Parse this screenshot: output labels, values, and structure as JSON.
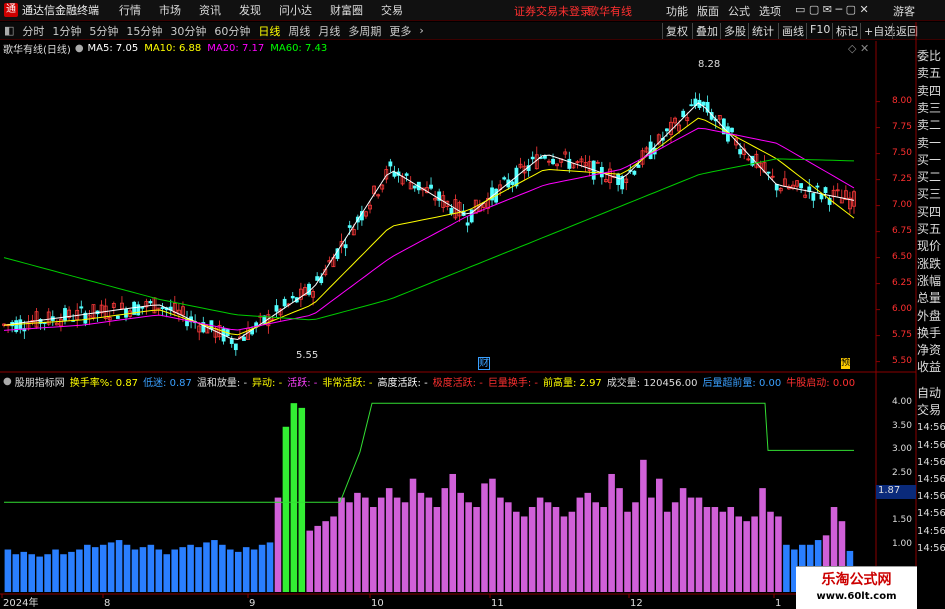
{
  "menubar": {
    "app_title": "通达信金融终端",
    "items": [
      "行情",
      "市场",
      "资讯",
      "发现",
      "问小达",
      "财富圈",
      "交易"
    ],
    "warning": "证券交易未登录",
    "stock_name": "歌华有线",
    "right_items": [
      "功能",
      "版面",
      "公式",
      "选项"
    ],
    "user": "游客"
  },
  "periodbar": {
    "periods": [
      "分时",
      "1分钟",
      "5分钟",
      "15分钟",
      "30分钟",
      "60分钟",
      "日线",
      "周线",
      "月线",
      "多周期",
      "更多"
    ],
    "active": "日线",
    "tools": [
      "复权",
      "叠加",
      "多股",
      "统计",
      "画线",
      "F10",
      "标记",
      "+自选",
      "返回"
    ]
  },
  "price_panel": {
    "title": "歌华有线(日线)",
    "ma_labels": [
      {
        "text": "MA5: 7.05",
        "color": "#ffffff"
      },
      {
        "text": "MA10: 6.88",
        "color": "#ffff00"
      },
      {
        "text": "MA20: 7.17",
        "color": "#ff00ff"
      },
      {
        "text": "MA60: 7.43",
        "color": "#00ff00"
      }
    ],
    "y_ticks": [
      "8.00",
      "7.75",
      "7.50",
      "7.25",
      "7.00",
      "6.75",
      "6.50",
      "6.25",
      "6.00",
      "5.75",
      "5.50"
    ],
    "high_label": "8.28",
    "low_label": "5.55",
    "marker_cai": "财",
    "marker_yu": "预"
  },
  "indicator_panel": {
    "title": "股朋指标网",
    "segments": [
      {
        "text": "换手率%: 0.87",
        "color": "#ffff00"
      },
      {
        "text": "低迷: 0.87",
        "color": "#3aa0ff"
      },
      {
        "text": "温和放量: -",
        "color": "#dddddd"
      },
      {
        "text": "异动: -",
        "color": "#ffff00"
      },
      {
        "text": "活跃: -",
        "color": "#ff40ff"
      },
      {
        "text": "非常活跃: -",
        "color": "#ffff00"
      },
      {
        "text": "高度活跃: -",
        "color": "#ffffff"
      },
      {
        "text": "极度活跃: -",
        "color": "#ff3030"
      },
      {
        "text": "巨量换手: -",
        "color": "#ff3030"
      },
      {
        "text": "前高量: 2.97",
        "color": "#ffff00"
      },
      {
        "text": "成交量: 120456.00",
        "color": "#dddddd"
      },
      {
        "text": "后量超前量: 0.00",
        "color": "#3aa0ff"
      },
      {
        "text": "牛股启动: 0.00",
        "color": "#ff3030"
      }
    ],
    "y_ticks": [
      "4.00",
      "3.50",
      "3.00",
      "2.50",
      "2.00",
      "1.50",
      "1.00"
    ],
    "current_value": "1.87"
  },
  "right_sidebar": {
    "upper": [
      "委比",
      "卖五",
      "卖四",
      "卖三",
      "卖二",
      "卖一",
      "买一",
      "买二",
      "买三",
      "买四",
      "买五",
      "现价",
      "涨跌",
      "涨幅",
      "总量",
      "外盘",
      "换手",
      "净资",
      "收益"
    ],
    "lower": [
      "自动",
      "交易",
      "14:56",
      "14:56",
      "14:56",
      "14:56",
      "14:56",
      "14:56",
      "14:56",
      "14:56"
    ]
  },
  "x_axis": [
    "2024年",
    "8",
    "9",
    "10",
    "11",
    "12",
    "1"
  ],
  "watermark": {
    "title": "乐淘公式网",
    "url": "www.60lt.com"
  },
  "chart_data": [
    {
      "type": "candlestick",
      "title": "歌华有线(日线)",
      "ylim": [
        5.4,
        8.4
      ],
      "x": [
        "2024-07",
        "2024-08",
        "2024-09",
        "2024-10",
        "2024-11",
        "2024-12",
        "2025-01"
      ],
      "series": [
        {
          "name": "MA5",
          "values": [
            5.85,
            5.95,
            6.05,
            5.7,
            6.2,
            7.35,
            6.9,
            7.5,
            7.25,
            8.0,
            7.2,
            7.05
          ]
        },
        {
          "name": "MA10",
          "values": [
            5.85,
            5.9,
            6.0,
            5.75,
            6.05,
            6.8,
            6.95,
            7.35,
            7.3,
            7.85,
            7.45,
            6.88
          ]
        },
        {
          "name": "MA20",
          "values": [
            5.8,
            5.85,
            5.95,
            5.8,
            5.95,
            6.5,
            6.9,
            7.2,
            7.35,
            7.75,
            7.6,
            7.17
          ]
        },
        {
          "name": "MA60",
          "values": [
            6.5,
            6.3,
            6.1,
            5.95,
            5.9,
            6.1,
            6.4,
            6.7,
            7.0,
            7.3,
            7.45,
            7.43
          ]
        }
      ],
      "annotations": [
        {
          "label": "8.28"
        },
        {
          "label": "5.55"
        }
      ]
    },
    {
      "type": "bar",
      "title": "股朋指标网",
      "ylim": [
        0,
        4.3
      ],
      "series": [
        {
          "name": "换手率%",
          "values": [
            0.9,
            0.8,
            0.85,
            0.8,
            0.75,
            0.8,
            0.9,
            0.8,
            0.85,
            0.9,
            1.0,
            0.95,
            1.0,
            1.05,
            1.1,
            1.0,
            0.9,
            0.95,
            1.0,
            0.9,
            0.8,
            0.9,
            0.95,
            1.0,
            0.95,
            1.05,
            1.1,
            1.0,
            0.9,
            0.85,
            0.95,
            0.9,
            1.0,
            1.05,
            2.0,
            3.5,
            4.0,
            3.9,
            1.3,
            1.4,
            1.5,
            1.6,
            2.0,
            1.9,
            2.1,
            2.0,
            1.8,
            2.0,
            2.2,
            2.0,
            1.9,
            2.4,
            2.1,
            2.0,
            1.8,
            2.2,
            2.5,
            2.1,
            1.9,
            1.8,
            2.3,
            2.4,
            2.0,
            1.9,
            1.7,
            1.6,
            1.8,
            2.0,
            1.9,
            1.8,
            1.6,
            1.7,
            2.0,
            2.1,
            1.9,
            1.8,
            2.5,
            2.2,
            1.7,
            1.9,
            2.8,
            2.0,
            2.4,
            1.7,
            1.9,
            2.2,
            2.0,
            2.0,
            1.8,
            1.8,
            1.7,
            1.8,
            1.6,
            1.5,
            1.6,
            2.2,
            1.7,
            1.6,
            1.0,
            0.9,
            1.0,
            1.0,
            1.1,
            1.2,
            1.8,
            1.5,
            0.87
          ]
        },
        {
          "name": "前高量",
          "values": [
            1.9,
            1.9,
            2.97,
            4.0,
            4.0,
            3.0
          ]
        }
      ]
    }
  ]
}
